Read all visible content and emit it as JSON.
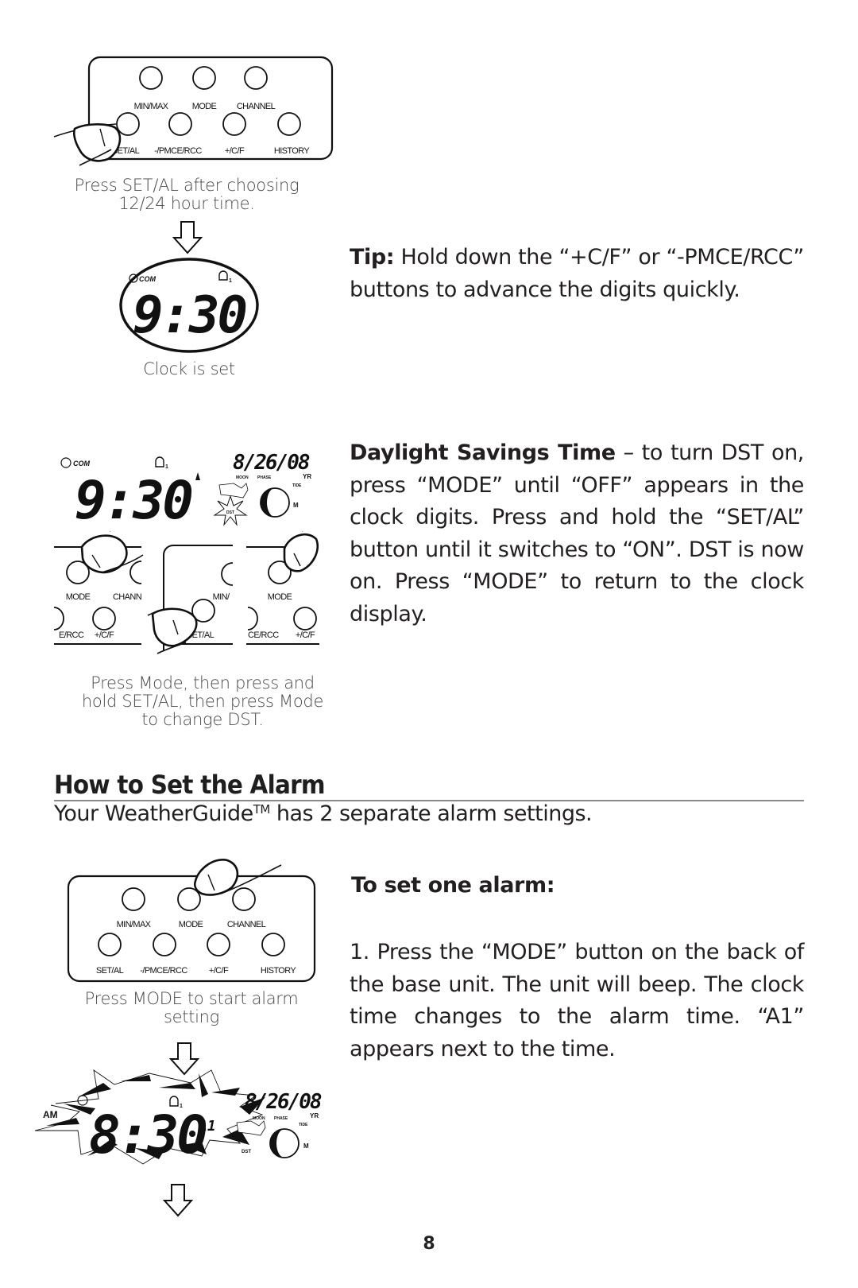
{
  "panel_buttons": {
    "top_row": [
      "MIN/MAX",
      "MODE",
      "CHANNEL"
    ],
    "bottom_row": [
      "SET/AL",
      "-/PMCE/RCC",
      "+/C/F",
      "HISTORY"
    ]
  },
  "step1": {
    "caption_line1": "Press SET/AL after choosing",
    "caption_line2": "12/24 hour time."
  },
  "clock_set": {
    "com_label": "COM",
    "time": "9:30",
    "alarm_index": "1",
    "caption": "Clock is set"
  },
  "tip": {
    "label": "Tip:",
    "text": "Hold down the “+C/F” or “-PMCE/RCC” buttons to advance the digits quickly."
  },
  "dst_display": {
    "com_label": "COM",
    "time": "9:30",
    "date": "8/26/08",
    "labels": {
      "moon": "MOON",
      "phase": "PHASE",
      "yr": "YR",
      "tide": "TIDE",
      "m": "M",
      "dst": "DST"
    },
    "alarm_index": "1"
  },
  "dst_strips": {
    "strip1": {
      "labels": [
        "MODE",
        "CHANN",
        "E/RCC",
        "+/C/F"
      ]
    },
    "strip2": {
      "labels": [
        "MIN/",
        "SET/AL"
      ]
    },
    "strip3": {
      "labels": [
        "MODE",
        "CE/RCC",
        "+/C/F"
      ]
    }
  },
  "dst_caption": {
    "line1": "Press Mode, then press and",
    "line2": "hold SET/AL, then press Mode",
    "line3": "to change DST."
  },
  "dst": {
    "label": "Daylight Savings Time",
    "text": " – to turn DST on, press “MODE” until “OFF” appears in the clock digits. Press and hold the “SET/AL” button until it switches to “ON”. DST is now on. Press “MODE” to return to the clock display."
  },
  "alarm_section": {
    "heading": "How to Set the Alarm",
    "intro_prefix": "Your WeatherGuide",
    "intro_tm": "TM",
    "intro_suffix": " has 2 separate alarm settings.",
    "subheading": "To set one alarm:",
    "step1": "1. Press the “MODE” button on the back of the base unit. The unit will beep. The clock time changes to the alarm time. “A1” appears next to the time.",
    "panel_caption_line1": "Press MODE to start alarm",
    "panel_caption_line2": "setting"
  },
  "alarm_display": {
    "am": "AM",
    "time": "8:30",
    "alarm_tag": "A1",
    "date": "8/26/08",
    "labels": {
      "moon": "MOON",
      "phase": "PHASE",
      "yr": "YR",
      "tide": "TIDE",
      "m": "M",
      "dst": "DST"
    },
    "alarm_index": "1"
  },
  "page_number": "8"
}
